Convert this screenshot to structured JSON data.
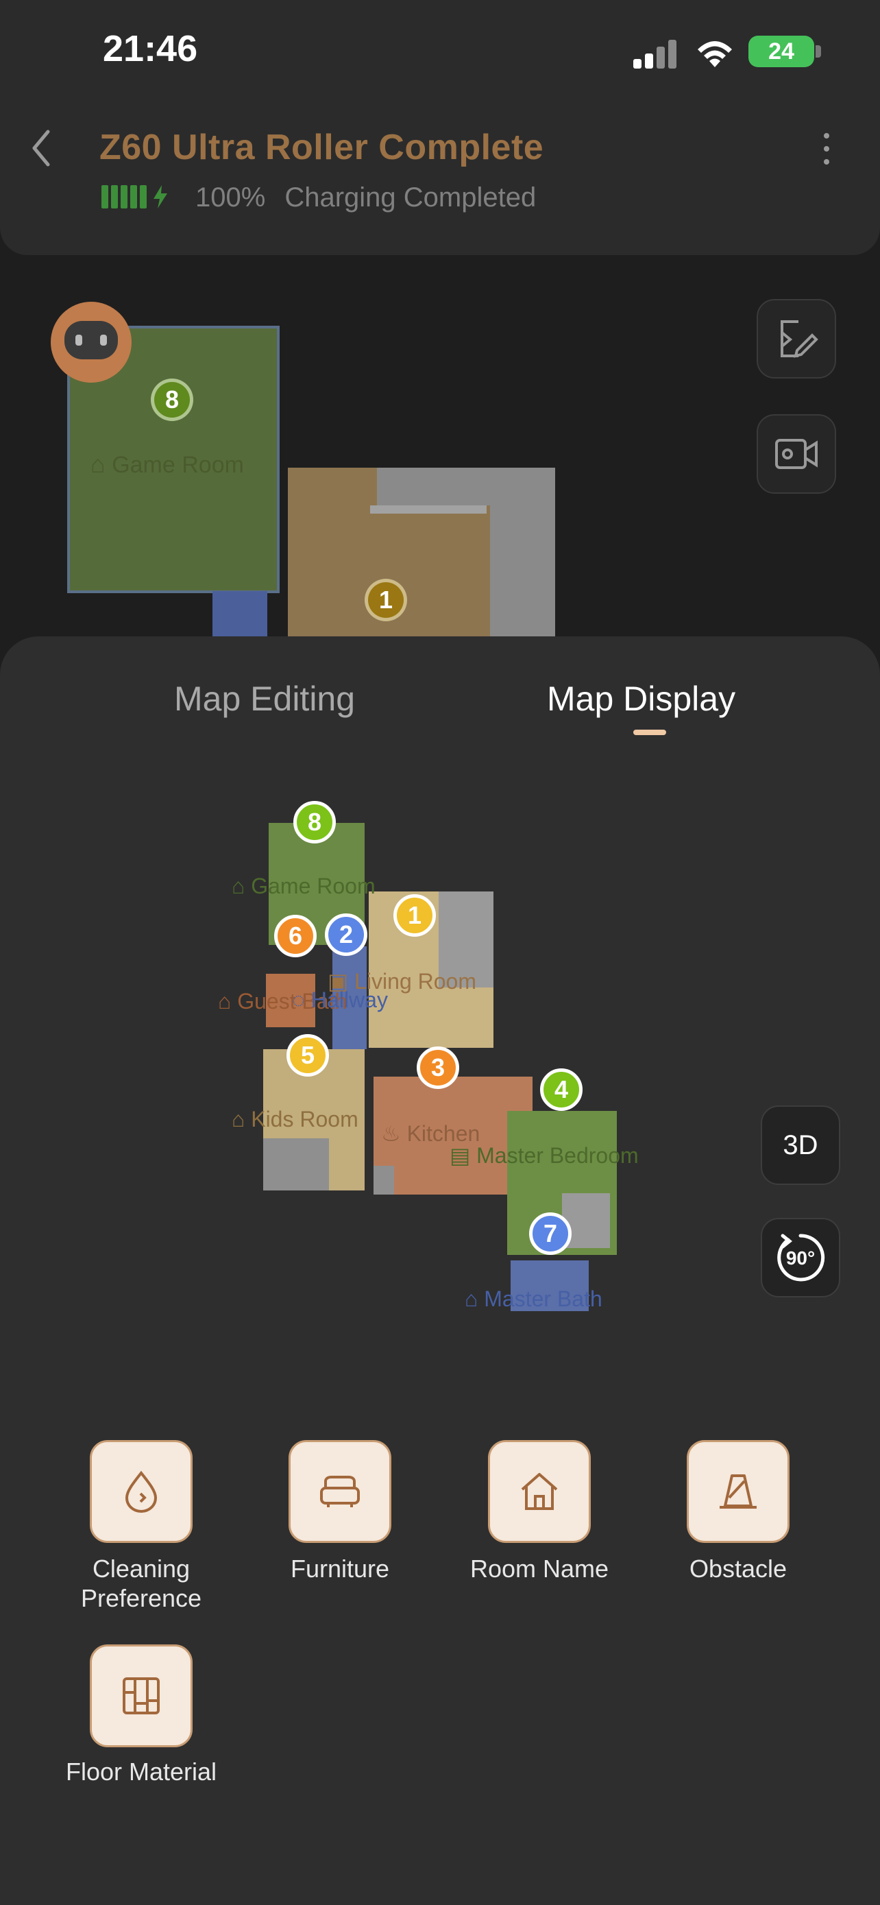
{
  "status_bar": {
    "time": "21:46",
    "battery": "24"
  },
  "header": {
    "title": "Z60 Ultra Roller Complete",
    "battery_percent": "100%",
    "status": "Charging Completed"
  },
  "top_map": {
    "rooms": [
      {
        "number": "8",
        "name": "Game Room",
        "color": "#5a7a3a"
      },
      {
        "number": "1",
        "name": "Living Room",
        "color": "#b8860b"
      }
    ]
  },
  "tabs": {
    "map_editing": "Map Editing",
    "map_display": "Map Display",
    "active": "Map Display"
  },
  "map": {
    "rooms": [
      {
        "number": "8",
        "name": "Game Room",
        "pin_color": "#7cc218"
      },
      {
        "number": "1",
        "name": "Living Room",
        "pin_color": "#f1c02a"
      },
      {
        "number": "6",
        "name": "Guest Bath",
        "pin_color": "#f28b26"
      },
      {
        "number": "2",
        "name": "Hallway",
        "pin_color": "#5b86e5"
      },
      {
        "number": "5",
        "name": "Kids Room",
        "pin_color": "#f1c02a"
      },
      {
        "number": "3",
        "name": "Kitchen",
        "pin_color": "#f28b26"
      },
      {
        "number": "4",
        "name": "Master Bedroom",
        "pin_color": "#7cc218"
      },
      {
        "number": "7",
        "name": "Master Bath",
        "pin_color": "#5b86e5"
      }
    ]
  },
  "view_buttons": {
    "three_d": "3D",
    "rotate": "90°"
  },
  "tools": [
    {
      "label": "Cleaning Preference",
      "icon": "water-drop-icon"
    },
    {
      "label": "Furniture",
      "icon": "sofa-icon"
    },
    {
      "label": "Room Name",
      "icon": "house-icon"
    },
    {
      "label": "Obstacle",
      "icon": "cone-icon"
    },
    {
      "label": "Floor Material",
      "icon": "floor-tile-icon"
    }
  ],
  "colors": {
    "accent": "#9b7145",
    "tool_bg": "#f6e9dd",
    "tool_border": "#c89c73",
    "indicator": "#f0c9a5"
  }
}
